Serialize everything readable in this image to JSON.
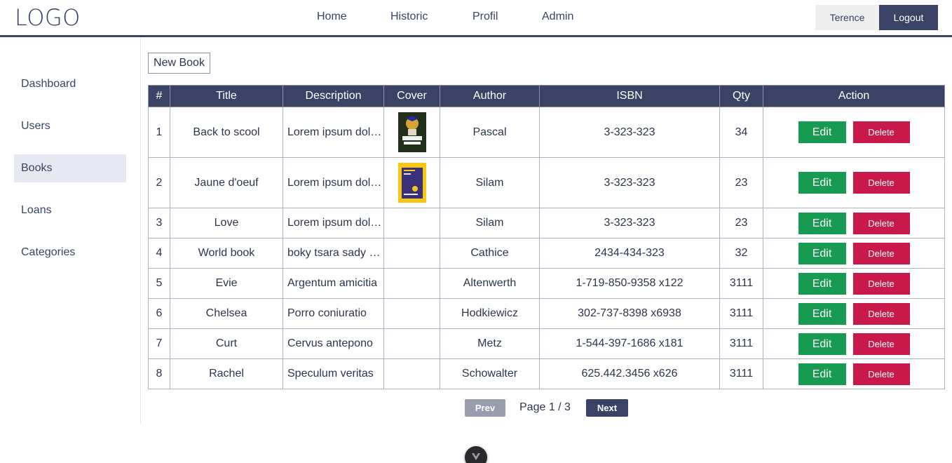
{
  "header": {
    "logo": "LOGO",
    "nav": [
      {
        "label": "Home"
      },
      {
        "label": "Historic"
      },
      {
        "label": "Profil"
      },
      {
        "label": "Admin"
      }
    ],
    "user_name": "Terence",
    "logout_label": "Logout"
  },
  "sidebar": {
    "items": [
      {
        "label": "Dashboard"
      },
      {
        "label": "Users"
      },
      {
        "label": "Books",
        "active": true
      },
      {
        "label": "Loans"
      },
      {
        "label": "Categories"
      }
    ]
  },
  "toolbar": {
    "new_book_label": "New Book"
  },
  "table": {
    "columns": [
      "#",
      "Title",
      "Description",
      "Cover",
      "Author",
      "ISBN",
      "Qty",
      "Action"
    ],
    "rows": [
      {
        "id": "1",
        "title": "Back to scool",
        "description": "Lorem ipsum dolor sit amet",
        "cover": "book-cover-back-to-school",
        "author": "Pascal",
        "isbn": "3-323-323",
        "qty": "34"
      },
      {
        "id": "2",
        "title": "Jaune d'oeuf",
        "description": "Lorem ipsum dolor sit amet",
        "cover": "book-cover-yellow",
        "author": "Silam",
        "isbn": "3-323-323",
        "qty": "23"
      },
      {
        "id": "3",
        "title": "Love",
        "description": "Lorem ipsum dolor sit amet",
        "cover": "",
        "author": "Silam",
        "isbn": "3-323-323",
        "qty": "23"
      },
      {
        "id": "4",
        "title": "World book",
        "description": "boky tsara sady mahafinaritra",
        "cover": "",
        "author": "Cathice",
        "isbn": "2434-434-323",
        "qty": "32"
      },
      {
        "id": "5",
        "title": "Evie",
        "description": "Argentum amicitia",
        "cover": "",
        "author": "Altenwerth",
        "isbn": "1-719-850-9358 x122",
        "qty": "3111"
      },
      {
        "id": "6",
        "title": "Chelsea",
        "description": "Porro coniuratio",
        "cover": "",
        "author": "Hodkiewicz",
        "isbn": "302-737-8398 x6938",
        "qty": "3111"
      },
      {
        "id": "7",
        "title": "Curt",
        "description": "Cervus antepono",
        "cover": "",
        "author": "Metz",
        "isbn": "1-544-397-1686 x181",
        "qty": "3111"
      },
      {
        "id": "8",
        "title": "Rachel",
        "description": "Speculum veritas",
        "cover": "",
        "author": "Schowalter",
        "isbn": "625.442.3456 x626",
        "qty": "3111"
      }
    ],
    "edit_label": "Edit",
    "delete_label": "Delete"
  },
  "pagination": {
    "prev_label": "Prev",
    "page_text": "Page 1 / 3",
    "next_label": "Next"
  },
  "colors": {
    "primary": "#3a4366",
    "edit": "#179a52",
    "delete": "#c8194a",
    "active_bg": "#e6e9f2"
  }
}
